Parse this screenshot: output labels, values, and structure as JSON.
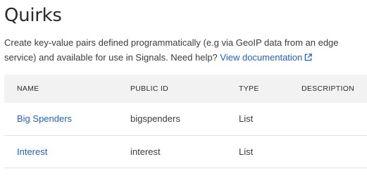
{
  "header": {
    "title": "Quirks",
    "description": "Create key-value pairs defined programmatically (e.g via GeoIP data from an edge service) and available for use in Signals. Need help?",
    "doc_link_label": "View documentation",
    "link_color": "#1f5fcf"
  },
  "table": {
    "columns": [
      "NAME",
      "PUBLIC ID",
      "TYPE",
      "DESCRIPTION"
    ],
    "rows": [
      {
        "name": "Big Spenders",
        "public_id": "bigspenders",
        "type": "List",
        "description": ""
      },
      {
        "name": "Interest",
        "public_id": "interest",
        "type": "List",
        "description": ""
      }
    ],
    "header_bg": "#f2f2f3"
  },
  "icons": {
    "doc_link": "external-link-icon"
  }
}
